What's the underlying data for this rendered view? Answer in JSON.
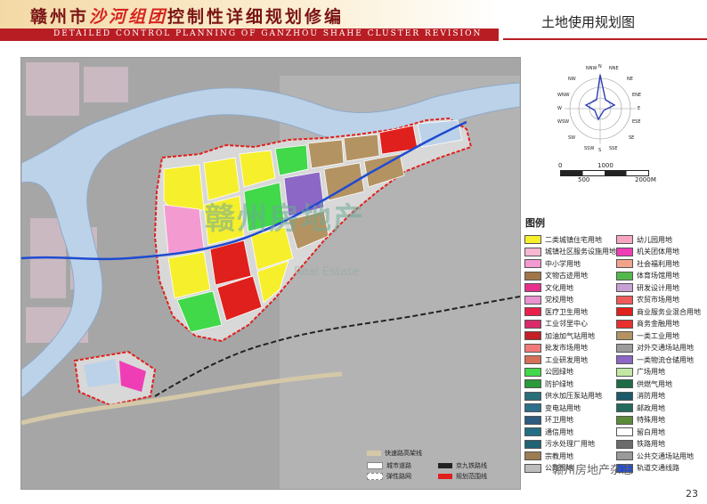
{
  "header": {
    "title_part1": "赣州市",
    "title_highlight": "沙河组团",
    "title_part2": "控制性详细规划修编",
    "subtitle": "DETAILED CONTROL PLANNING OF GANZHOU SHAHE CLUSTER REVISION",
    "page_heading": "土地使用规划图"
  },
  "compass": {
    "labels": [
      "NNW",
      "N",
      "NNE",
      "NW",
      "NE",
      "WNW",
      "ENE",
      "W",
      "E",
      "WSW",
      "ESE",
      "SW",
      "SE",
      "SSW",
      "S",
      "SSE"
    ]
  },
  "scale": {
    "labels_top": [
      "0",
      "1000"
    ],
    "labels_bottom": [
      "500",
      "2000M"
    ]
  },
  "legend": {
    "title": "图例",
    "items": [
      {
        "label": "二类城镇住宅用地",
        "color": "#f6ef2c"
      },
      {
        "label": "幼儿园用地",
        "color": "#f7a6c2"
      },
      {
        "label": "城镇社区服务设施用地",
        "color": "#f7b7d2"
      },
      {
        "label": "机关团体用地",
        "color": "#ef3db6"
      },
      {
        "label": "中小学用地",
        "color": "#f39ad1"
      },
      {
        "label": "社会福利用地",
        "color": "#f0a48a"
      },
      {
        "label": "文物古迹用地",
        "color": "#a1764a"
      },
      {
        "label": "体育场馆用地",
        "color": "#53b84b"
      },
      {
        "label": "文化用地",
        "color": "#e7308c"
      },
      {
        "label": "研发设计用地",
        "color": "#c8a0d4"
      },
      {
        "label": "党校用地",
        "color": "#ea93cf"
      },
      {
        "label": "农贸市场用地",
        "color": "#f05a5a"
      },
      {
        "label": "医疗卫生用地",
        "color": "#e8204b"
      },
      {
        "label": "商业服务业混合用地",
        "color": "#e0201c"
      },
      {
        "label": "工业邻里中心",
        "color": "#d92a6b"
      },
      {
        "label": "商务金融用地",
        "color": "#e8302f"
      },
      {
        "label": "加油加气站用地",
        "color": "#c32027"
      },
      {
        "label": "一类工业用地",
        "color": "#b49363"
      },
      {
        "label": "批发市场用地",
        "color": "#f07a7a"
      },
      {
        "label": "对外交通场站用地",
        "color": "#9c9c9c"
      },
      {
        "label": "工业研发用地",
        "color": "#d66f57"
      },
      {
        "label": "一类物流仓储用地",
        "color": "#8c67c5"
      },
      {
        "label": "公园绿地",
        "color": "#41d84a"
      },
      {
        "label": "广场用地",
        "color": "#c2e8a4"
      },
      {
        "label": "防护绿地",
        "color": "#2a9a3a"
      },
      {
        "label": "供燃气用地",
        "color": "#1e6b4a"
      },
      {
        "label": "供水加压泵站用地",
        "color": "#2a6e7a"
      },
      {
        "label": "消防用地",
        "color": "#1c5a6a"
      },
      {
        "label": "变电站用地",
        "color": "#2e6f8a"
      },
      {
        "label": "邮政用地",
        "color": "#236a5a"
      },
      {
        "label": "环卫用地",
        "color": "#2d5c7e"
      },
      {
        "label": "特殊用地",
        "color": "#5c8a3a"
      },
      {
        "label": "通信用地",
        "color": "#246e85"
      },
      {
        "label": "留白用地",
        "color": "#ffffff"
      },
      {
        "label": "污水处理厂用地",
        "color": "#1f6273"
      },
      {
        "label": "铁路用地",
        "color": "#6b6b6b"
      },
      {
        "label": "宗教用地",
        "color": "#9e7b52"
      },
      {
        "label": "公共交通场站用地",
        "color": "#9a9a9a"
      },
      {
        "label": "公路用地",
        "color": "#bdbdbd"
      },
      {
        "label": "轨道交通线路",
        "color": "#1f4bd1"
      }
    ]
  },
  "map_legend": {
    "items": [
      {
        "label": "快速路高架线",
        "color": "#d4c8a8"
      },
      {
        "label": "城市道路",
        "color": "#ffffff"
      },
      {
        "label": "京九铁路线",
        "color": "#222222"
      },
      {
        "label": "弹性路网",
        "color": "#ffffff"
      },
      {
        "label": "规划范围线",
        "color": "#e0201c"
      }
    ]
  },
  "watermark": {
    "big": "赣州房地产",
    "sub": "Real Estate",
    "brand": "赣州房地产杂志"
  },
  "page_number": "23"
}
